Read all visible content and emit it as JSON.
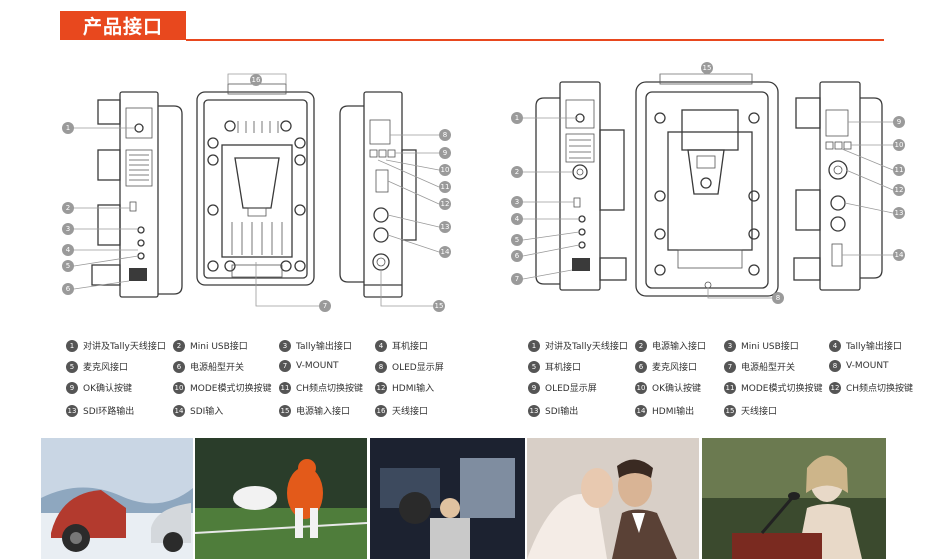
{
  "section_title": "产品接口",
  "left_callouts": [
    "1",
    "2",
    "3",
    "4",
    "5",
    "6",
    "7",
    "8",
    "9",
    "10",
    "11",
    "12",
    "13",
    "14",
    "15",
    "16"
  ],
  "right_callouts": [
    "1",
    "2",
    "3",
    "4",
    "5",
    "6",
    "7",
    "8",
    "9",
    "10",
    "11",
    "12",
    "13",
    "14",
    "15"
  ],
  "left_legend": [
    {
      "num": "1",
      "label": "对讲及Tally天线接口"
    },
    {
      "num": "2",
      "label": "Mini USB接口"
    },
    {
      "num": "3",
      "label": "Tally输出接口"
    },
    {
      "num": "4",
      "label": "耳机接口"
    },
    {
      "num": "5",
      "label": "麦克风接口"
    },
    {
      "num": "6",
      "label": "电源船型开关"
    },
    {
      "num": "7",
      "label": "V-MOUNT"
    },
    {
      "num": "8",
      "label": "OLED显示屏"
    },
    {
      "num": "9",
      "label": "OK确认按键"
    },
    {
      "num": "10",
      "label": "MODE模式切换按键"
    },
    {
      "num": "11",
      "label": "CH频点切换按键"
    },
    {
      "num": "12",
      "label": "HDMI输入"
    },
    {
      "num": "13",
      "label": "SDI环路输出"
    },
    {
      "num": "14",
      "label": "SDI输入"
    },
    {
      "num": "15",
      "label": "电源输入接口"
    },
    {
      "num": "16",
      "label": "天线接口"
    }
  ],
  "right_legend": [
    {
      "num": "1",
      "label": "对讲及Tally天线接口"
    },
    {
      "num": "2",
      "label": "电源输入接口"
    },
    {
      "num": "3",
      "label": "Mini USB接口"
    },
    {
      "num": "4",
      "label": "Tally输出接口"
    },
    {
      "num": "5",
      "label": "耳机接口"
    },
    {
      "num": "6",
      "label": "麦克风接口"
    },
    {
      "num": "7",
      "label": "电源船型开关"
    },
    {
      "num": "8",
      "label": "V-MOUNT"
    },
    {
      "num": "9",
      "label": "OLED显示屏"
    },
    {
      "num": "10",
      "label": "OK确认按键"
    },
    {
      "num": "11",
      "label": "MODE模式切换按键"
    },
    {
      "num": "12",
      "label": "CH频点切换按键"
    },
    {
      "num": "13",
      "label": "SDI输出"
    },
    {
      "num": "14",
      "label": "HDMI输出"
    },
    {
      "num": "15",
      "label": "天线接口"
    }
  ],
  "photos": [
    {
      "name": "snow-car-photo",
      "colors": [
        "#c9d6e4",
        "#8ea7bf",
        "#e9eef3",
        "#b33a2e"
      ]
    },
    {
      "name": "football-photo",
      "colors": [
        "#2a3d2a",
        "#4f7d3b",
        "#e35a1a",
        "#f2f2f2"
      ]
    },
    {
      "name": "film-crew-photo",
      "colors": [
        "#1c2230",
        "#3d4a5e",
        "#7f8da0",
        "#c9c9c9"
      ]
    },
    {
      "name": "wedding-photo",
      "colors": [
        "#d8cfc7",
        "#f4ece6",
        "#5a4136",
        "#ffffff"
      ]
    },
    {
      "name": "speaker-photo",
      "colors": [
        "#3b4a2e",
        "#6b7a50",
        "#e8d9c8",
        "#7a2a20"
      ]
    }
  ]
}
